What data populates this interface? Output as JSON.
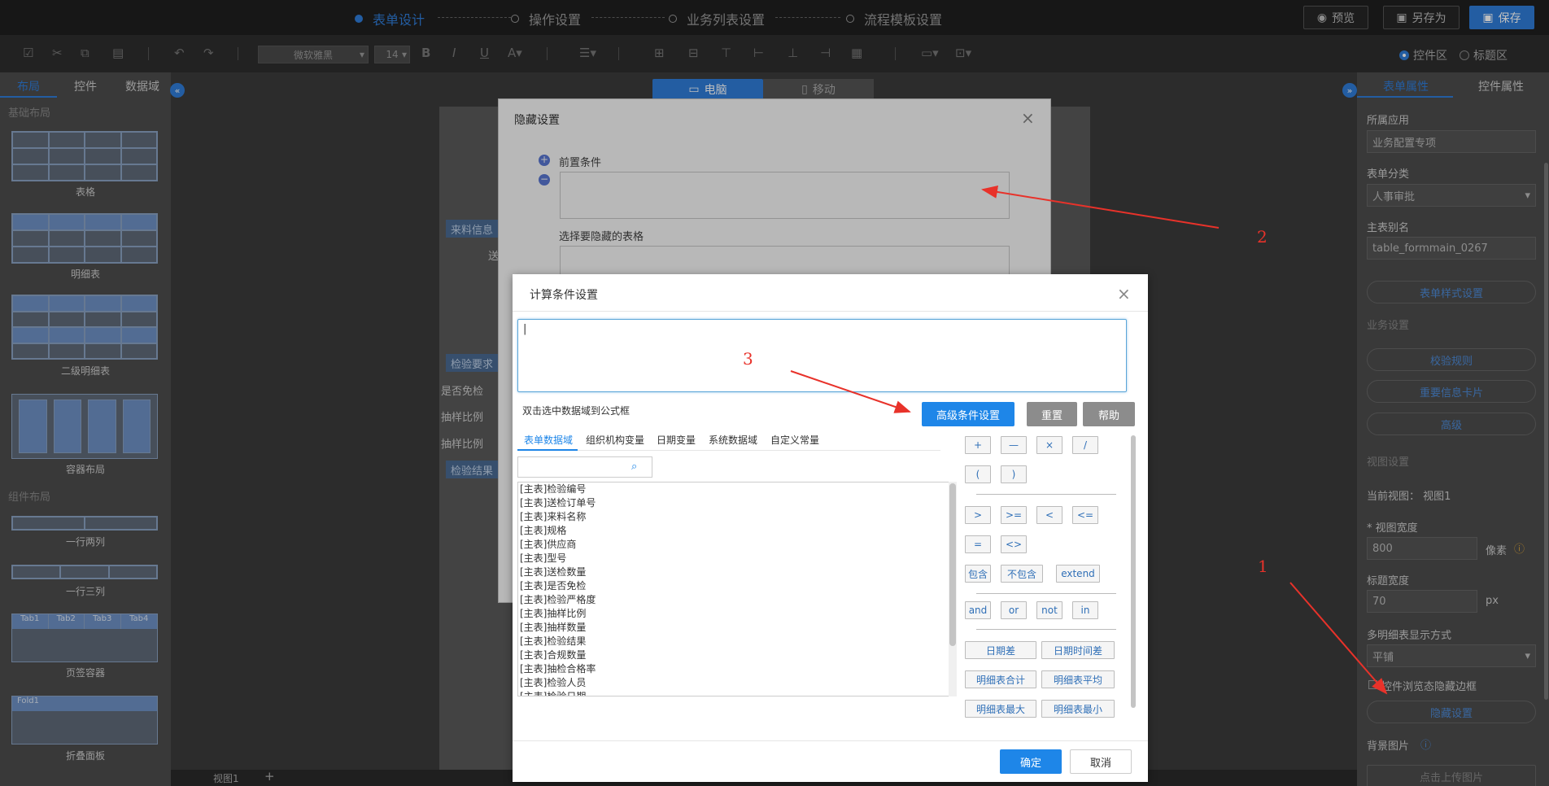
{
  "steps": [
    "表单设计",
    "操作设置",
    "业务列表设置",
    "流程模板设置"
  ],
  "top_buttons": {
    "preview": "预览",
    "save_as": "另存为",
    "save": "保存"
  },
  "toolbar": {
    "font": "微软雅黑",
    "size": "14",
    "radio_control_area": "控件区",
    "radio_title_area": "标题区"
  },
  "left_panel": {
    "tabs": [
      "布局",
      "控件",
      "数据域"
    ],
    "section_basic": "基础布局",
    "section_component": "组件布局",
    "items": [
      "表格",
      "明细表",
      "二级明细表",
      "容器布局",
      "一行两列",
      "一行三列",
      "页签容器",
      "折叠面板"
    ],
    "tab_container_tabs": [
      "Tab1",
      "Tab2",
      "Tab3",
      "Tab4"
    ],
    "fold_label": "Fold1"
  },
  "center": {
    "view_tabs": [
      "电脑",
      "移动"
    ],
    "form_sections": [
      "来料信息",
      "检验要求",
      "检验结果"
    ],
    "form_labels": [
      "送",
      "是否免检",
      "抽样比例",
      "抽样比例"
    ],
    "bottom_tab": "视图1",
    "add_tab": "+"
  },
  "right_panel": {
    "tabs": [
      "表单属性",
      "控件属性"
    ],
    "app_label": "所属应用",
    "app_value": "业务配置专项",
    "category_label": "表单分类",
    "category_value": "人事审批",
    "alias_label": "主表别名",
    "alias_value": "table_formmain_0267",
    "style_button": "表单样式设置",
    "business_section": "业务设置",
    "verify_button": "校验规则",
    "card_button": "重要信息卡片",
    "advanced_button": "高级",
    "view_section": "视图设置",
    "current_view": "当前视图：  视图1",
    "view_width_label": "* 视图宽度",
    "view_width_value": "800",
    "view_width_unit": "像素",
    "title_width_label": "标题宽度",
    "title_width_value": "70",
    "title_width_unit": "px",
    "detail_mode_label": "多明细表显示方式",
    "detail_mode_value": "平铺",
    "hide_border_label": "控件浏览态隐藏边框",
    "hide_button": "隐藏设置",
    "bg_label": "背景图片",
    "upload_button": "点击上传图片"
  },
  "hidden_dialog": {
    "title": "隐藏设置",
    "precondition_label": "前置条件",
    "select_table_label": "选择要隐藏的表格"
  },
  "calc_dialog": {
    "title": "计算条件设置",
    "formula_value": "|",
    "hint": "双击选中数据域到公式框",
    "advanced_button": "高级条件设置",
    "reset_button": "重置",
    "help_button": "帮助",
    "tabs": [
      "表单数据域",
      "组织机构变量",
      "日期变量",
      "系统数据域",
      "自定义常量"
    ],
    "fields": [
      "[主表]检验编号",
      "[主表]送检订单号",
      "[主表]来料名称",
      "[主表]规格",
      "[主表]供应商",
      "[主表]型号",
      "[主表]送检数量",
      "[主表]是否免检",
      "[主表]检验严格度",
      "[主表]抽样比例",
      "[主表]抽样数量",
      "[主表]检验结果",
      "[主表]合规数量",
      "[主表]抽检合格率",
      "[主表]检验人员",
      "[主表]检验日期"
    ],
    "ops_row1": [
      "+",
      "—",
      "×",
      "/"
    ],
    "ops_row2": [
      "(",
      ")"
    ],
    "ops_row3": [
      ">",
      ">=",
      "<",
      "<="
    ],
    "ops_row4": [
      "=",
      "<>"
    ],
    "ops_row5": [
      "包含",
      "不包含",
      "extend"
    ],
    "ops_row6": [
      "and",
      "or",
      "not",
      "in"
    ],
    "func_buttons": [
      "日期差",
      "日期时间差",
      "明细表合计",
      "明细表平均",
      "明细表最大",
      "明细表最小"
    ],
    "ok_button": "确定",
    "cancel_button": "取消"
  },
  "annotations": [
    "1",
    "2",
    "3"
  ],
  "colors": {
    "accent": "#1e86e8",
    "annotation": "#e8322a",
    "dark_bg": "#1f1f1f"
  }
}
